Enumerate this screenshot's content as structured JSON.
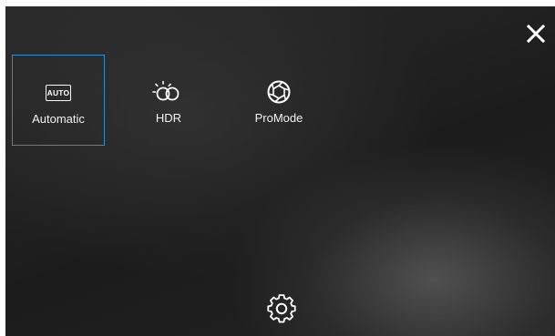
{
  "modes": [
    {
      "label": "Automatic",
      "icon": "auto-icon",
      "icon_text": "AUTO",
      "selected": true
    },
    {
      "label": "HDR",
      "icon": "hdr-icon",
      "selected": false
    },
    {
      "label": "ProMode",
      "icon": "aperture-icon",
      "selected": false
    }
  ],
  "controls": {
    "close_icon": "close-icon",
    "settings_icon": "gear-icon"
  },
  "colors": {
    "selection_border": "#2f8bd0",
    "text": "#ffffff",
    "background": "#1f1f1f"
  }
}
